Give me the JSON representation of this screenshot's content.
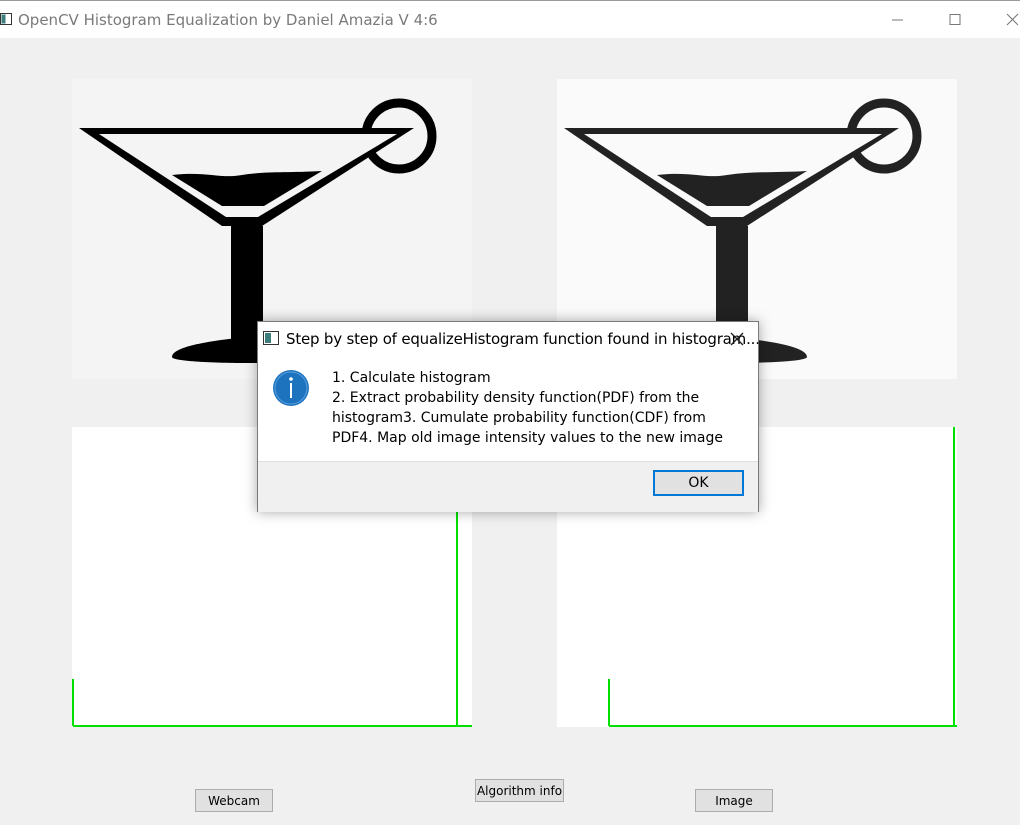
{
  "window": {
    "title": "OpenCV Histogram Equalization by Daniel Amazia V 4:6",
    "controls": {
      "minimize": "minimize-icon",
      "maximize": "maximize-icon",
      "close": "close-icon"
    }
  },
  "panels": {
    "original_image": "cocktail-glass-image",
    "equalized_image": "cocktail-glass-image-equalized",
    "histogram_color": "#00e000"
  },
  "buttons": {
    "webcam": "Webcam",
    "algorithm_info": "Algorithm info",
    "image": "Image"
  },
  "dialog": {
    "title": "Step by step of equalizeHistogram function found in histogram...",
    "icon": "info-icon",
    "message": "1. Calculate histogram\n2. Extract probability density function(PDF) from the histogram3. Cumulate probability function(CDF) from PDF4. Map old image intensity values to the new image",
    "ok": "OK"
  },
  "colors": {
    "accent": "#0078d7",
    "info_icon": "#1e73be"
  }
}
